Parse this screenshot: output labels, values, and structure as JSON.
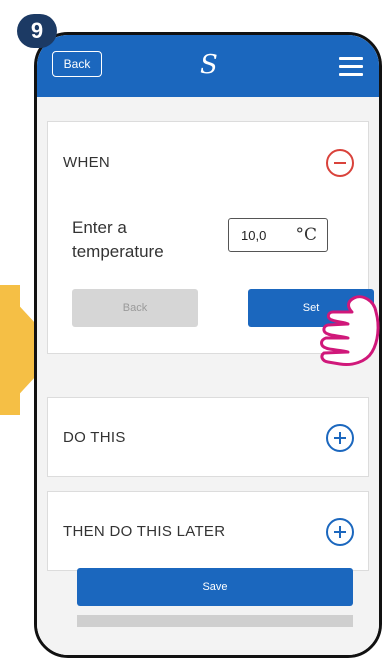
{
  "step_badge": "9",
  "header": {
    "back_label": "Back",
    "logo_glyph": "S",
    "menu_icon": "hamburger-menu-icon",
    "bg_color": "#1b67be"
  },
  "when": {
    "title": "WHEN",
    "toggle_icon": "minus-circle-icon",
    "toggle_color": "#d9423b",
    "prompt": "Enter a temperature",
    "temperature_value": "10,0",
    "unit": "°C",
    "back_label": "Back",
    "set_label": "Set"
  },
  "do_this": {
    "title": "DO THIS",
    "toggle_icon": "plus-circle-icon"
  },
  "then_do_this_later": {
    "title": "THEN DO THIS LATER",
    "toggle_icon": "plus-circle-icon"
  },
  "save_label": "Save",
  "accent_color": "#1b67be",
  "highlight_color": "#f5bf45"
}
